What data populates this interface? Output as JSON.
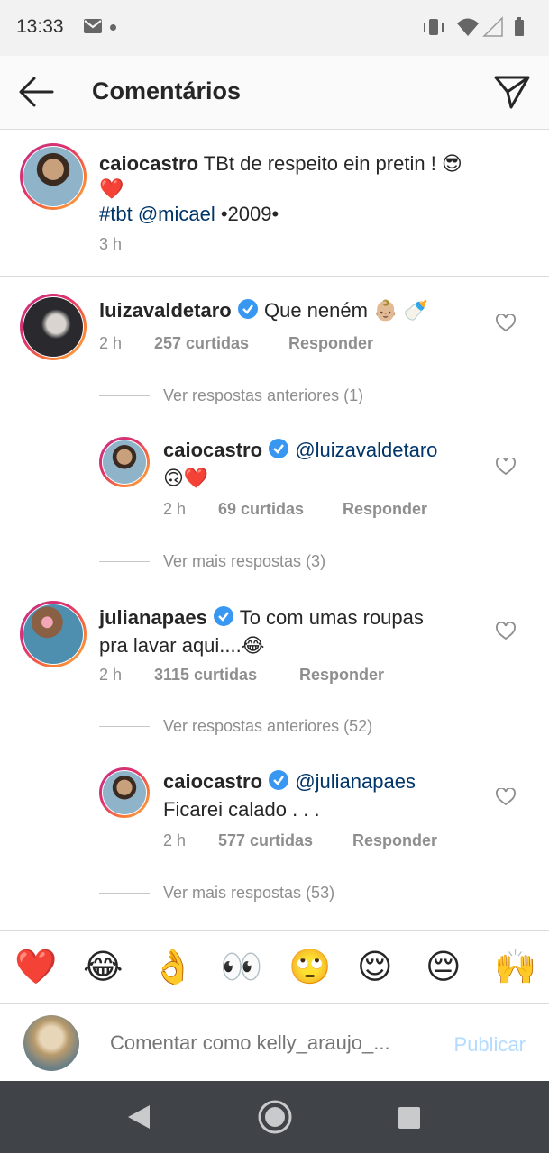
{
  "status_bar": {
    "time": "13:33"
  },
  "header": {
    "title": "Comentários",
    "back_icon": "arrow-left-icon",
    "share_icon": "paper-plane-icon"
  },
  "caption": {
    "username": "caiocastro",
    "text": "TBt de respeito ein pretin ! 😎",
    "text_line2": "❤️",
    "hashtag": "#tbt",
    "mention": "@micael",
    "tail": "•2009•",
    "time": "3 h"
  },
  "comments": [
    {
      "username": "luizavaldetaro",
      "verified": true,
      "text": "Que neném 👶🏼 🍼",
      "time": "2 h",
      "likes": "257 curtidas",
      "reply": "Responder",
      "thread_link": "Ver respostas anteriores (1)",
      "replies": [
        {
          "username": "caiocastro",
          "verified": true,
          "mention": "@luizavaldetaro",
          "text": "🙃❤️",
          "time": "2 h",
          "likes": "69 curtidas",
          "reply": "Responder"
        }
      ],
      "more_link": "Ver mais respostas (3)"
    },
    {
      "username": "julianapaes",
      "verified": true,
      "text": "To com umas roupas",
      "text_line2": "pra lavar aqui....😂",
      "time": "2 h",
      "likes": "3115 curtidas",
      "reply": "Responder",
      "thread_link": "Ver respostas anteriores (52)",
      "replies": [
        {
          "username": "caiocastro",
          "verified": true,
          "mention": "@julianapaes",
          "text": "Ficarei calado . . .",
          "time": "2 h",
          "likes": "577 curtidas",
          "reply": "Responder"
        }
      ],
      "more_link": "Ver mais respostas (53)"
    }
  ],
  "emoji_bar": [
    "❤️",
    "😂",
    "👌",
    "👀",
    "🙄",
    "😌",
    "😔",
    "🙌"
  ],
  "composer": {
    "placeholder": "Comentar como kelly_araujo_...",
    "publish": "Publicar"
  },
  "colors": {
    "link": "#003569",
    "verified": "#3897f0",
    "muted": "#8e8e8e",
    "publish_disabled": "#b3dbff"
  }
}
